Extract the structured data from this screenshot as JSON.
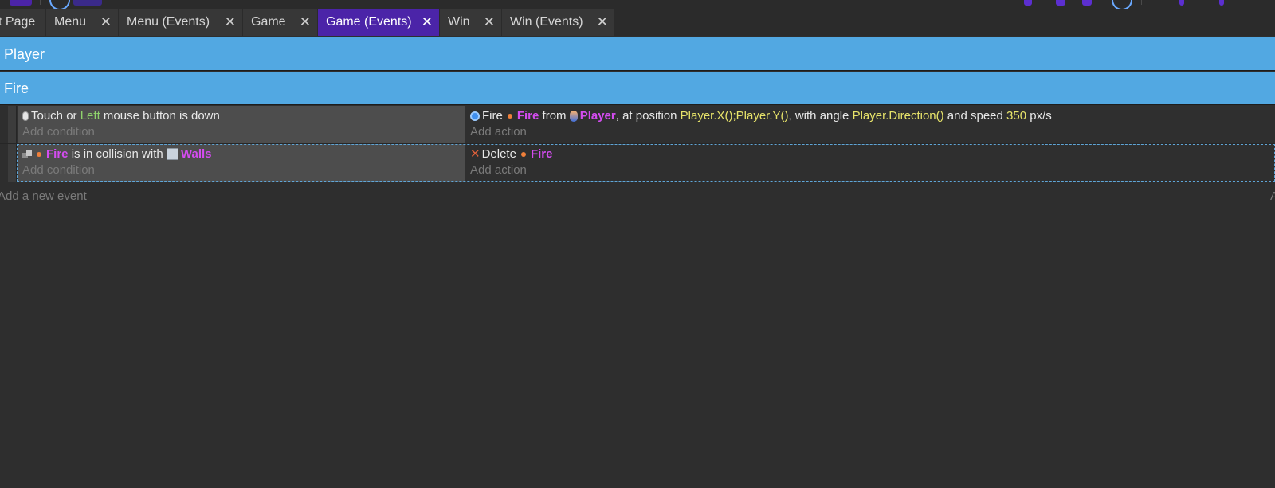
{
  "tabs": [
    {
      "label": "t Page",
      "closable": false,
      "active": false
    },
    {
      "label": "Menu",
      "closable": true,
      "active": false
    },
    {
      "label": "Menu (Events)",
      "closable": true,
      "active": false
    },
    {
      "label": "Game",
      "closable": true,
      "active": false
    },
    {
      "label": "Game (Events)",
      "closable": true,
      "active": true
    },
    {
      "label": "Win",
      "closable": true,
      "active": false
    },
    {
      "label": "Win (Events)",
      "closable": true,
      "active": false
    }
  ],
  "close_glyph": "✕",
  "groups": {
    "player": "Player",
    "fire": "Fire"
  },
  "events": [
    {
      "condition": {
        "icon": "mouse-icon",
        "prefix": "Touch or",
        "button": "Left",
        "suffix": "mouse button is down"
      },
      "add_condition": "Add condition",
      "action": {
        "icon": "gear-icon",
        "verb": "Fire",
        "object": "Fire",
        "from_word": "from",
        "source": "Player",
        "at_position": ", at position",
        "position": "Player.X();Player.Y()",
        "with_angle": ", with angle",
        "angle": "Player.Direction()",
        "and_speed": "and speed",
        "speed": "350",
        "unit": "px/s"
      },
      "add_action": "Add action"
    },
    {
      "condition": {
        "icon": "collision-icon",
        "object": "Fire",
        "text": "is in collision with",
        "target": "Walls"
      },
      "add_condition": "Add condition",
      "action": {
        "icon": "delete-icon",
        "verb": "Delete",
        "object": "Fire"
      },
      "add_action": "Add action"
    }
  ],
  "add_event": "Add a new event",
  "right_hint": "A",
  "colors": {
    "background": "#2e2e2e",
    "tab_active": "#4b24a8",
    "group_header": "#52a8e2",
    "object_name": "#d44cf0",
    "expression": "#e7e36a",
    "parameter_green": "#8fd36c"
  }
}
